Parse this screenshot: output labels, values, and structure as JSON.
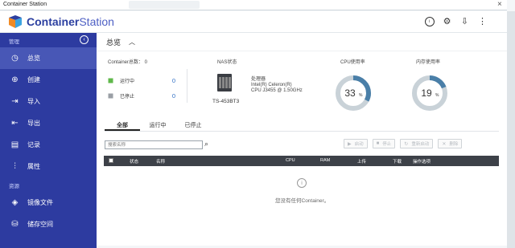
{
  "window": {
    "title": "Container Station"
  },
  "header": {
    "brand_bold": "Container",
    "brand_light": "Station"
  },
  "sidebar": {
    "section_manage": "管理",
    "items_manage": [
      {
        "label": "总览",
        "icon": "gauge-icon"
      },
      {
        "label": "创建",
        "icon": "plus-circle-icon"
      },
      {
        "label": "导入",
        "icon": "import-icon"
      },
      {
        "label": "导出",
        "icon": "export-icon"
      },
      {
        "label": "记录",
        "icon": "log-icon"
      },
      {
        "label": "属性",
        "icon": "sliders-icon"
      }
    ],
    "section_resources": "资源",
    "items_resources": [
      {
        "label": "镜像文件",
        "icon": "layers-icon"
      },
      {
        "label": "储存空间",
        "icon": "database-icon"
      }
    ]
  },
  "main": {
    "breadcrumb": "总览",
    "summary": {
      "title": "Container总数： 0",
      "running_label": "运行中",
      "running_value": "0",
      "stopped_label": "已停止",
      "stopped_value": "0"
    },
    "nas": {
      "title": "NAS状态",
      "model": "TS-453BT3",
      "proc_label": "处理器",
      "proc_line1": "Intel(R) Celeron(R)",
      "proc_line2": "CPU J3455 @ 1.50GHz"
    },
    "cpu": {
      "title": "CPU使用率",
      "value": "33",
      "unit": "%",
      "fraction": 0.33
    },
    "ram": {
      "title": "内存使用率",
      "value": "19",
      "unit": "%",
      "fraction": 0.19
    },
    "tabs": [
      "全部",
      "运行中",
      "已停止"
    ],
    "search": {
      "placeholder": "搜索名称"
    },
    "actions": [
      "启动",
      "停止",
      "重新启动",
      "删除"
    ],
    "table_headers": [
      "状态",
      "名称",
      "CPU",
      "RAM",
      "上传",
      "下载",
      "操作选项"
    ],
    "empty_message": "您没有任何Container。"
  },
  "colors": {
    "sidebar": "#2d3ba0",
    "gauge_fill": "#4a7fa8",
    "gauge_track": "#c9d2d8",
    "accent": "#2f6fc4"
  }
}
